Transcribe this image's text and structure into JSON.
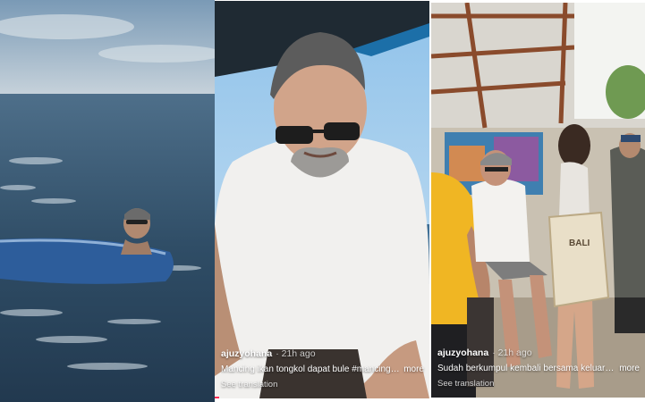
{
  "panels": [
    {
      "scene": "sea-swimmer",
      "caption": null
    },
    {
      "scene": "boat-man",
      "username": "ajuzyohana",
      "age": "· 21h ago",
      "caption": "Mancing ikan tongkol dapat bule #mancing ...",
      "more_label": "more",
      "translate_label": "See translation",
      "progress": 0.02
    },
    {
      "scene": "family-reunion",
      "username": "ajuzyohana",
      "age": "· 21h ago",
      "caption": "Sudah berkumpul kembali bersama keluarga 🙏 ...",
      "more_label": "more",
      "translate_label": "See translation",
      "progress": 0.0,
      "bag_text": "BALI"
    }
  ]
}
